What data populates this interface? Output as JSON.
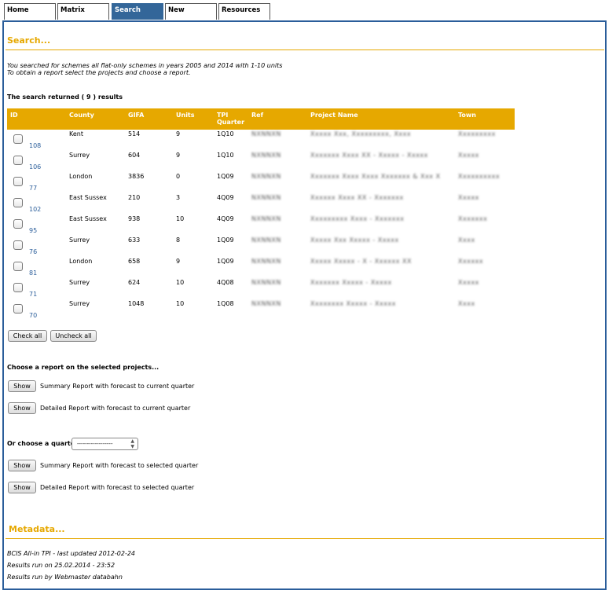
{
  "tabs": [
    {
      "label": "Home",
      "active": false
    },
    {
      "label": "Matrix",
      "active": false
    },
    {
      "label": "Search",
      "active": true
    },
    {
      "label": "New",
      "active": false
    },
    {
      "label": "Resources",
      "active": false
    }
  ],
  "search": {
    "title": "Search...",
    "intro_line1": "You searched for schemes all flat-only schemes in years 2005 and 2014 with 1-10 units",
    "intro_line2": "To obtain a report select the projects and choose a report.",
    "results_count": "The search returned ( 9 ) results"
  },
  "table": {
    "headers": {
      "id": "ID",
      "county": "County",
      "gifa": "GIFA",
      "units": "Units",
      "tpi": "TPI Quarter",
      "ref": "Ref",
      "project": "Project Name",
      "town": "Town"
    },
    "rows": [
      {
        "id": "108",
        "county": "Kent",
        "gifa": "514",
        "units": "9",
        "tpi": "1Q10",
        "ref": "NXNNXN",
        "project": "Xxxxx Xxx, Xxxxxxxxx, Xxxx",
        "town": "Xxxxxxxxx"
      },
      {
        "id": "106",
        "county": "Surrey",
        "gifa": "604",
        "units": "9",
        "tpi": "1Q10",
        "ref": "NXNNXN",
        "project": "Xxxxxxx Xxxx XX - Xxxxx - Xxxxx",
        "town": "Xxxxx"
      },
      {
        "id": "77",
        "county": "London",
        "gifa": "3836",
        "units": "0",
        "tpi": "1Q09",
        "ref": "NXNNXN",
        "project": "Xxxxxxx Xxxx Xxxx Xxxxxxx & Xxx Xxxx",
        "town": "Xxxxxxxxxx"
      },
      {
        "id": "102",
        "county": "East Sussex",
        "gifa": "210",
        "units": "3",
        "tpi": "4Q09",
        "ref": "NXNNXN",
        "project": "Xxxxxx Xxxx XX - Xxxxxxx",
        "town": "Xxxxx"
      },
      {
        "id": "95",
        "county": "East Sussex",
        "gifa": "938",
        "units": "10",
        "tpi": "4Q09",
        "ref": "NXNNXN",
        "project": "Xxxxxxxxx Xxxx - Xxxxxxx",
        "town": "Xxxxxxx"
      },
      {
        "id": "76",
        "county": "Surrey",
        "gifa": "633",
        "units": "8",
        "tpi": "1Q09",
        "ref": "NXNNXN",
        "project": "Xxxxx Xxx Xxxxx - Xxxxx",
        "town": "Xxxx"
      },
      {
        "id": "81",
        "county": "London",
        "gifa": "658",
        "units": "9",
        "tpi": "1Q09",
        "ref": "NXNNXN",
        "project": "Xxxxx Xxxxx - X - Xxxxxx XX",
        "town": "Xxxxxx"
      },
      {
        "id": "71",
        "county": "Surrey",
        "gifa": "624",
        "units": "10",
        "tpi": "4Q08",
        "ref": "NXNNXN",
        "project": "Xxxxxxx Xxxxx - Xxxxx",
        "town": "Xxxxx"
      },
      {
        "id": "70",
        "county": "Surrey",
        "gifa": "1048",
        "units": "10",
        "tpi": "1Q08",
        "ref": "NXNNXN",
        "project": "Xxxxxxxx Xxxxx - Xxxxx",
        "town": "Xxxx"
      }
    ]
  },
  "buttons": {
    "check_all": "Check all",
    "uncheck_all": "Uncheck all",
    "show": "Show"
  },
  "reports": {
    "choose_label": "Choose a report on the selected projects...",
    "summary_current": "Summary Report with forecast to current quarter",
    "detailed_current": "Detailed Report with forecast to current quarter",
    "quarter_label": "Or choose a quarter",
    "quarter_value": "------------------",
    "summary_selected": "Summary Report with forecast to selected quarter",
    "detailed_selected": "Detailed Report with forecast to selected quarter"
  },
  "metadata": {
    "title": "Metadata...",
    "line1": "BCIS All-in TPI - last updated 2012-02-24",
    "line2": "Results run on 25.02.2014 - 23:52",
    "line3": "Results run by Webmaster databahn"
  },
  "colors": {
    "accent": "#e6a800",
    "nav_active": "#336699",
    "frame": "#2a5d9a",
    "link": "#2a5d9a"
  }
}
